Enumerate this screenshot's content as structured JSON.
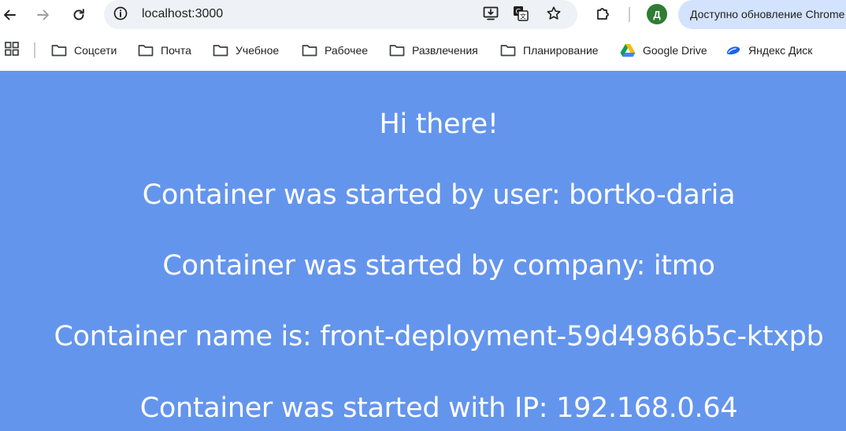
{
  "browser": {
    "url": "localhost:3000",
    "profile_initial": "Д",
    "update_chip_label": "Доступно обновление Chrome",
    "icons": {
      "back": "back-arrow-icon",
      "forward": "forward-arrow-icon",
      "reload": "reload-icon",
      "site_info": "site-info-icon",
      "install": "install-app-icon",
      "translate": "translate-icon",
      "bookmark": "star-icon",
      "extensions": "puzzle-icon"
    },
    "colors": {
      "omnibox": "#eef1f5",
      "update_chip": "#d3e3fd",
      "avatar": "#2e7d32"
    }
  },
  "bookmarks": {
    "items": [
      {
        "label": "Соцсети",
        "icon": "folder-icon"
      },
      {
        "label": "Почта",
        "icon": "folder-icon"
      },
      {
        "label": "Учебное",
        "icon": "folder-icon"
      },
      {
        "label": "Рабочее",
        "icon": "folder-icon"
      },
      {
        "label": "Развлечения",
        "icon": "folder-icon"
      },
      {
        "label": "Планирование",
        "icon": "folder-icon"
      },
      {
        "label": "Google Drive",
        "icon": "google-drive-icon"
      },
      {
        "label": "Яндекс Диск",
        "icon": "yandex-disk-icon"
      }
    ]
  },
  "page": {
    "background": "#6495ed",
    "greeting": "Hi there!",
    "user_line": "Container was started by user: bortko-daria",
    "company_line": "Container was started by company: itmo",
    "name_line": "Container name is: front-deployment-59d4986b5c-ktxpb",
    "ip_line": "Container was started with IP: 192.168.0.64"
  }
}
